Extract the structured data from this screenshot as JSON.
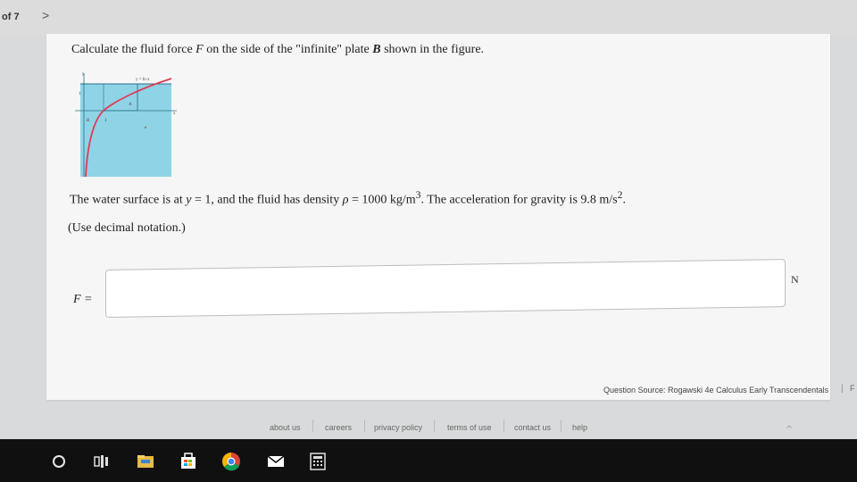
{
  "nav": {
    "page_of": "of 7",
    "next": ">"
  },
  "question": {
    "prompt_pre": "Calculate the fluid force ",
    "prompt_F": "F",
    "prompt_mid": " on the side of the \"infinite\" plate ",
    "prompt_B": "B",
    "prompt_post": " shown in the figure.",
    "water_line_pre": "The water surface is at ",
    "water_line_y": "y",
    "water_line_mid": " = 1, and the fluid has density ",
    "water_line_rho": "ρ",
    "water_line_density": " =  1000 kg/m",
    "water_line_exp3": "3",
    "water_line_gravity": ". The acceleration for gravity is 9.8 m/s",
    "water_line_exp2": "2",
    "water_line_end": ".",
    "notation": "(Use decimal notation.)"
  },
  "figure": {
    "curve_label": "y = ln x",
    "y_axis": "y",
    "x_axis": "x",
    "tick_y1": "1",
    "tick_x1": "1",
    "tick_e": "e",
    "region_A": "A",
    "region_B": "B",
    "colors": {
      "water": "#8fd3e6",
      "curve": "#e03a57",
      "frame": "#2a6f86"
    }
  },
  "answer": {
    "label": "F =",
    "value": "",
    "unit": "N"
  },
  "source": {
    "text": "Question Source: Rogawski 4e Calculus Early Transcendentals",
    "sep": "|",
    "cut": "F"
  },
  "footer": {
    "links": [
      "about us",
      "careers",
      "privacy policy",
      "terms of use",
      "contact us",
      "help"
    ]
  },
  "taskbar": {
    "icons": [
      "cortana-circle-icon",
      "task-view-icon",
      "file-explorer-icon",
      "store-icon",
      "chrome-icon",
      "mail-icon",
      "calculator-icon"
    ]
  },
  "tray": {
    "chevron": "^"
  }
}
